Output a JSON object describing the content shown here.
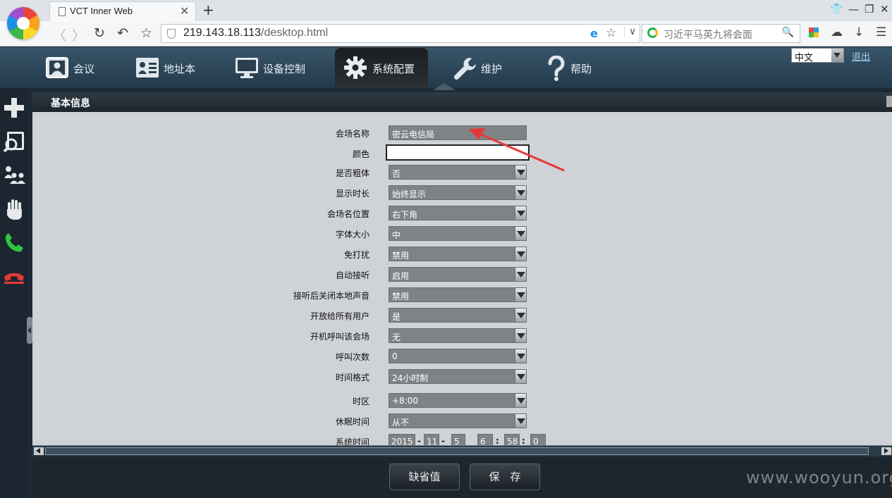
{
  "browser": {
    "tab_title": "VCT Inner Web",
    "url_host": "219.143.18.113",
    "url_path": "/desktop.html",
    "search_hint": "习近平马英九将会面"
  },
  "header": {
    "menu": [
      {
        "label": "会议",
        "icon": "monitor-user-icon"
      },
      {
        "label": "地址本",
        "icon": "address-card-icon"
      },
      {
        "label": "设备控制",
        "icon": "display-icon"
      },
      {
        "label": "系统配置",
        "icon": "gear-icon",
        "active": true
      },
      {
        "label": "维护",
        "icon": "wrench-icon"
      },
      {
        "label": "帮助",
        "icon": "question-icon"
      }
    ],
    "language": "中文",
    "logout": "退出"
  },
  "left_bar": {
    "icons": [
      "add-icon",
      "search-user-icon",
      "group-icon",
      "hand-icon",
      "call-icon",
      "hangup-icon"
    ]
  },
  "panel": {
    "title": "基本信息",
    "fields": [
      {
        "label": "会场名称",
        "value": "密云电信局",
        "type": "text"
      },
      {
        "label": "颜色",
        "value": "",
        "type": "white"
      },
      {
        "label": "是否粗体",
        "value": "否",
        "type": "select"
      },
      {
        "label": "显示时长",
        "value": "始终显示",
        "type": "select"
      },
      {
        "label": "会场名位置",
        "value": "右下角",
        "type": "select"
      },
      {
        "label": "字体大小",
        "value": "中",
        "type": "select"
      },
      {
        "label": "免打扰",
        "value": "禁用",
        "type": "select"
      },
      {
        "label": "自动接听",
        "value": "启用",
        "type": "select"
      },
      {
        "label": "接听后关闭本地声音",
        "value": "禁用",
        "type": "select"
      },
      {
        "label": "开放给所有用户",
        "value": "是",
        "type": "select"
      },
      {
        "label": "开机呼叫该会场",
        "value": "无",
        "type": "select"
      },
      {
        "label": "呼叫次数",
        "value": "0",
        "type": "select"
      },
      {
        "label": "时间格式",
        "value": "24小时制",
        "type": "select"
      },
      {
        "label": "时区",
        "value": "+8:00",
        "type": "select"
      },
      {
        "label": "休眠时间",
        "value": "从不",
        "type": "select"
      }
    ],
    "system_time": {
      "label": "系统时间",
      "year": "2015",
      "month": "11",
      "day": "5",
      "hour": "6",
      "minute": "58",
      "second": "0"
    }
  },
  "buttons": {
    "default": "缺省值",
    "save": "保　存"
  },
  "watermark": "www.wooyun.org",
  "colors": {
    "header": "#2d4a5e",
    "form_bg": "#cfd2d6",
    "field_bg": "#808386",
    "arrow": "#e53935"
  }
}
